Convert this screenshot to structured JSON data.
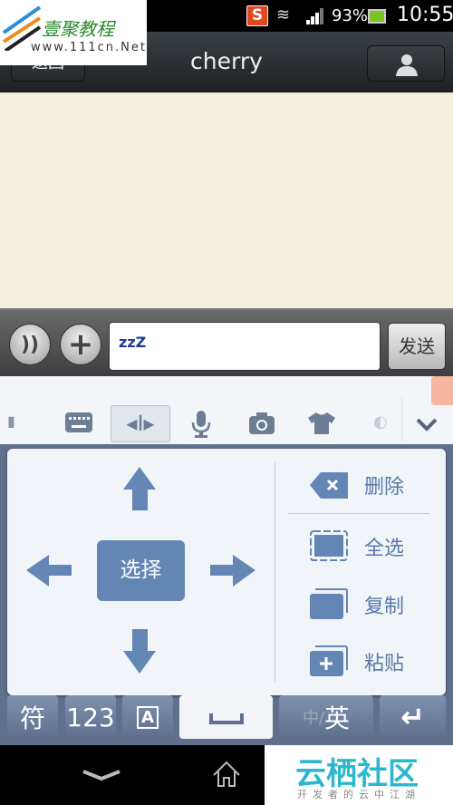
{
  "status_bar": {
    "battery": "93%",
    "time": "10:55",
    "app_badge": "S"
  },
  "title_bar": {
    "back_label": "返回",
    "title": "cherry",
    "contact_icon": "person-icon"
  },
  "watermarks": {
    "top_logo": "壹聚教程",
    "top_url": "www.111cn.Net",
    "bottom_logo": "云栖社区",
    "bottom_tagline": "开发者的云中江湖"
  },
  "input_bar": {
    "input_value": "zzZ",
    "send_label": "发送"
  },
  "keyboard_toolbar": {
    "items": [
      "menu-icon",
      "keyboard-icon",
      "cursor-icon",
      "mic-icon",
      "camera-icon",
      "shirt-icon",
      "emoji-icon"
    ],
    "collapse_icon": "chevron-down-icon"
  },
  "edit_popup": {
    "select_label": "选择",
    "delete_label": "删除",
    "select_all_label": "全选",
    "copy_label": "复制",
    "paste_label": "粘贴",
    "accent": "#6386b5"
  },
  "keyboard_keys": {
    "symbol": "符",
    "number": "123",
    "caps": "A",
    "lang_cn": "中/",
    "lang_en": "英"
  }
}
